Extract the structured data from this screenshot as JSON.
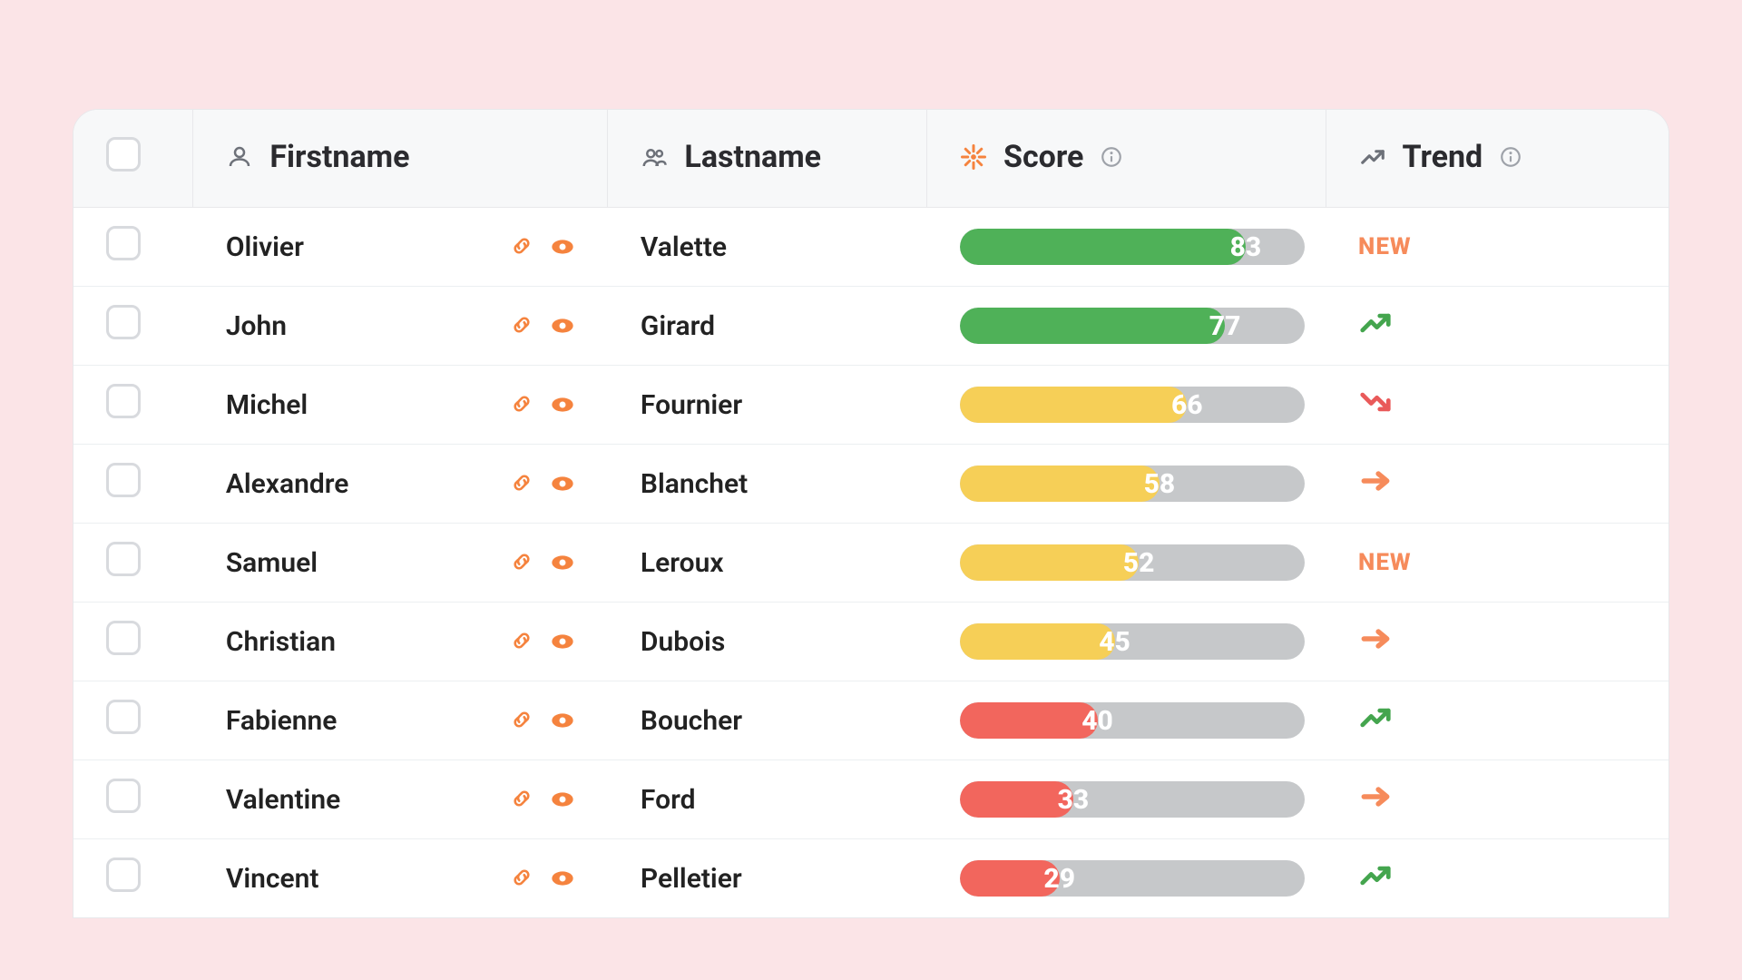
{
  "columns": {
    "firstname": "Firstname",
    "lastname": "Lastname",
    "score": "Score",
    "trend": "Trend"
  },
  "trend_labels": {
    "new": "NEW"
  },
  "colors": {
    "green": "#4fb158",
    "yellow": "#f6cf57",
    "red": "#f2665d",
    "accent": "#f5833e"
  },
  "rows": [
    {
      "firstname": "Olivier",
      "lastname": "Valette",
      "score": 83,
      "score_color": "green",
      "trend": "new"
    },
    {
      "firstname": "John",
      "lastname": "Girard",
      "score": 77,
      "score_color": "green",
      "trend": "up"
    },
    {
      "firstname": "Michel",
      "lastname": "Fournier",
      "score": 66,
      "score_color": "yellow",
      "trend": "down"
    },
    {
      "firstname": "Alexandre",
      "lastname": "Blanchet",
      "score": 58,
      "score_color": "yellow",
      "trend": "flat"
    },
    {
      "firstname": "Samuel",
      "lastname": "Leroux",
      "score": 52,
      "score_color": "yellow",
      "trend": "new"
    },
    {
      "firstname": "Christian",
      "lastname": "Dubois",
      "score": 45,
      "score_color": "yellow",
      "trend": "flat"
    },
    {
      "firstname": "Fabienne",
      "lastname": "Boucher",
      "score": 40,
      "score_color": "red",
      "trend": "up"
    },
    {
      "firstname": "Valentine",
      "lastname": "Ford",
      "score": 33,
      "score_color": "red",
      "trend": "flat"
    },
    {
      "firstname": "Vincent",
      "lastname": "Pelletier",
      "score": 29,
      "score_color": "red",
      "trend": "up"
    }
  ]
}
